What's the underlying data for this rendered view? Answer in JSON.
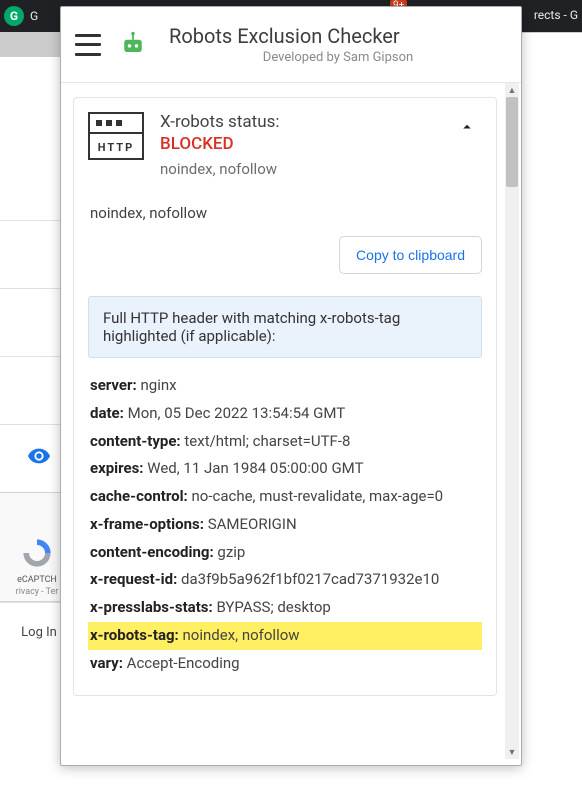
{
  "browser": {
    "left_tab_text": "G",
    "right_tab_fragment": "rects - G",
    "badge": "9+"
  },
  "sidebar": {
    "eye_label": "visibility",
    "captcha_label": "eCAPTCH",
    "captcha_privacy": "rivacy",
    "captcha_dash": "-",
    "captcha_terms": "Ter",
    "login": "Log In"
  },
  "popup": {
    "title": "Robots Exclusion Checker",
    "subtitle": "Developed by Sam Gipson"
  },
  "card": {
    "http_label": "HTTP",
    "status_title": "X-robots status:",
    "status_value": "BLOCKED",
    "status_sub": "noindex, nofollow",
    "detail": "noindex, nofollow",
    "copy_button": "Copy to clipboard",
    "info": "Full HTTP header with matching x-robots-tag highlighted (if applicable):",
    "headers": [
      {
        "key": "server:",
        "val": "nginx",
        "hl": false
      },
      {
        "key": "date:",
        "val": "Mon, 05 Dec 2022 13:54:54 GMT",
        "hl": false
      },
      {
        "key": "content-type:",
        "val": "text/html; charset=UTF-8",
        "hl": false
      },
      {
        "key": "expires:",
        "val": "Wed, 11 Jan 1984 05:00:00 GMT",
        "hl": false
      },
      {
        "key": "cache-control:",
        "val": "no-cache, must-revalidate, max-age=0",
        "hl": false
      },
      {
        "key": "x-frame-options:",
        "val": "SAMEORIGIN",
        "hl": false
      },
      {
        "key": "content-encoding:",
        "val": "gzip",
        "hl": false
      },
      {
        "key": "x-request-id:",
        "val": "da3f9b5a962f1bf0217cad7371932e10",
        "hl": false
      },
      {
        "key": "x-presslabs-stats:",
        "val": "BYPASS; desktop",
        "hl": false
      },
      {
        "key": "x-robots-tag:",
        "val": "noindex, nofollow",
        "hl": true
      },
      {
        "key": "vary:",
        "val": "Accept-Encoding",
        "hl": false
      }
    ]
  }
}
